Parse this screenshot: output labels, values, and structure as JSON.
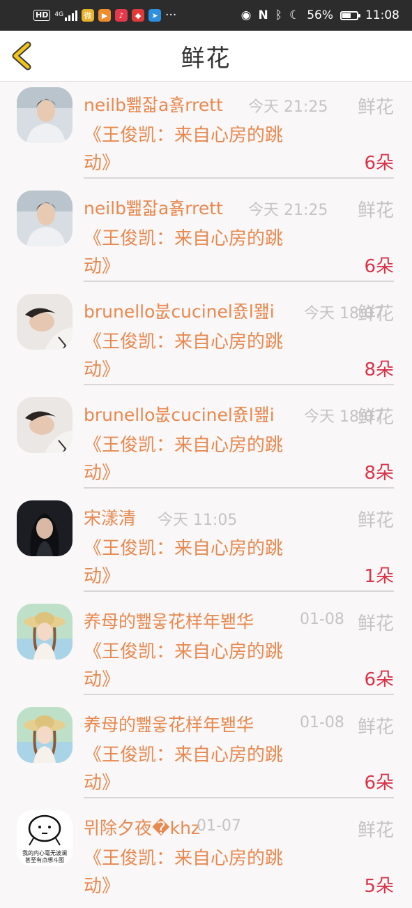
{
  "status_bar": {
    "network": "HD",
    "network_gen": "4G",
    "battery": "56%",
    "battery_level": 0.56,
    "time": "11:08",
    "more": "···"
  },
  "header": {
    "title": "鲜花"
  },
  "rows": [
    {
      "name": "neilb뾆잛a횱rrett",
      "time": "今天 21:25",
      "type": "鲜花",
      "work_line1": "《王俊凯：来自心房的跳",
      "work_line2": "动》",
      "count": "6朵",
      "avatar": "male-portrait-1"
    },
    {
      "name": "neilb뾆잛a횱rrett",
      "time": "今天 21:25",
      "type": "鲜花",
      "work_line1": "《王俊凯：来自心房的跳",
      "work_line2": "动》",
      "count": "6朵",
      "avatar": "male-portrait-1"
    },
    {
      "name": "brunello붒cucinel죬l뫮i",
      "time": "今天 18:07",
      "type": "鲜花",
      "work_line1": "《王俊凯：来自心房的跳",
      "work_line2": "动》",
      "count": "8朵",
      "avatar": "male-portrait-2"
    },
    {
      "name": "brunello붒cucinel죬l뫮i",
      "time": "今天 18:07",
      "type": "鲜花",
      "work_line1": "《王俊凯：来自心房的跳",
      "work_line2": "动》",
      "count": "8朵",
      "avatar": "male-portrait-2"
    },
    {
      "name": "宋漾清",
      "time": "今天 11:05",
      "type": "鲜花",
      "work_line1": "《王俊凯：来自心房的跳",
      "work_line2": "动》",
      "count": "1朵",
      "avatar": "female-portrait-dark"
    },
    {
      "name": "养母的뾆웋花样年봳华",
      "time": "01-08",
      "type": "鲜花",
      "work_line1": "《王俊凯：来自心房的跳",
      "work_line2": "动》",
      "count": "6朵",
      "avatar": "girl-straw-hat"
    },
    {
      "name": "养母的뾆웋花样年봳华",
      "time": "01-08",
      "type": "鲜花",
      "work_line1": "《王俊凯：来自心房的跳",
      "work_line2": "动》",
      "count": "6朵",
      "avatar": "girl-straw-hat"
    },
    {
      "name": "뮈除夕夜�khz",
      "time": "01-07",
      "type": "鲜花",
      "work_line1": "《王俊凯：来自心房的跳",
      "work_line2": "动》",
      "count": "5朵",
      "avatar": "cartoon-sticker",
      "avatar_text_1": "我的内心毫无波澜",
      "avatar_text_2": "甚至有点想斗图"
    }
  ],
  "colors": {
    "accent_orange": "#e8894f",
    "count_red": "#d9344a",
    "muted_gray": "#c4c4c4",
    "back_arrow": "#f0c419"
  }
}
